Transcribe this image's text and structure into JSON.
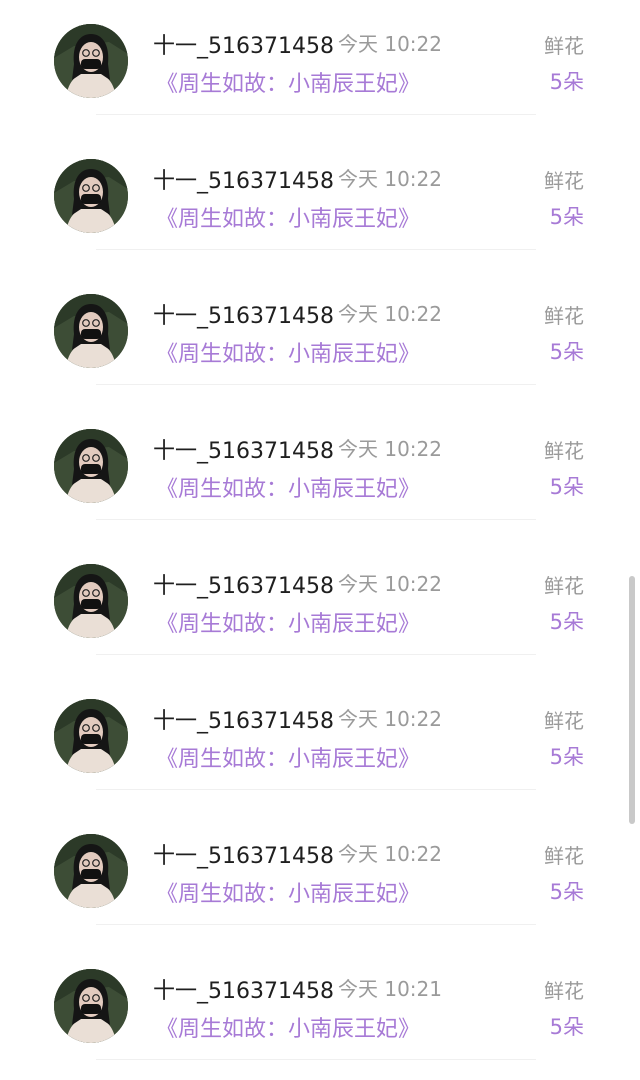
{
  "items": [
    {
      "username": "十一_516371458",
      "time": "今天 10:22",
      "book": "《周生如故：小南辰王妃》",
      "gift_type": "鲜花",
      "gift_count": "5朵"
    },
    {
      "username": "十一_516371458",
      "time": "今天 10:22",
      "book": "《周生如故：小南辰王妃》",
      "gift_type": "鲜花",
      "gift_count": "5朵"
    },
    {
      "username": "十一_516371458",
      "time": "今天 10:22",
      "book": "《周生如故：小南辰王妃》",
      "gift_type": "鲜花",
      "gift_count": "5朵"
    },
    {
      "username": "十一_516371458",
      "time": "今天 10:22",
      "book": "《周生如故：小南辰王妃》",
      "gift_type": "鲜花",
      "gift_count": "5朵"
    },
    {
      "username": "十一_516371458",
      "time": "今天 10:22",
      "book": "《周生如故：小南辰王妃》",
      "gift_type": "鲜花",
      "gift_count": "5朵"
    },
    {
      "username": "十一_516371458",
      "time": "今天 10:22",
      "book": "《周生如故：小南辰王妃》",
      "gift_type": "鲜花",
      "gift_count": "5朵"
    },
    {
      "username": "十一_516371458",
      "time": "今天 10:22",
      "book": "《周生如故：小南辰王妃》",
      "gift_type": "鲜花",
      "gift_count": "5朵"
    },
    {
      "username": "十一_516371458",
      "time": "今天 10:21",
      "book": "《周生如故：小南辰王妃》",
      "gift_type": "鲜花",
      "gift_count": "5朵"
    }
  ],
  "colors": {
    "accent": "#a77ad6",
    "muted": "#9a9a9a",
    "text": "#1f1f1f"
  }
}
